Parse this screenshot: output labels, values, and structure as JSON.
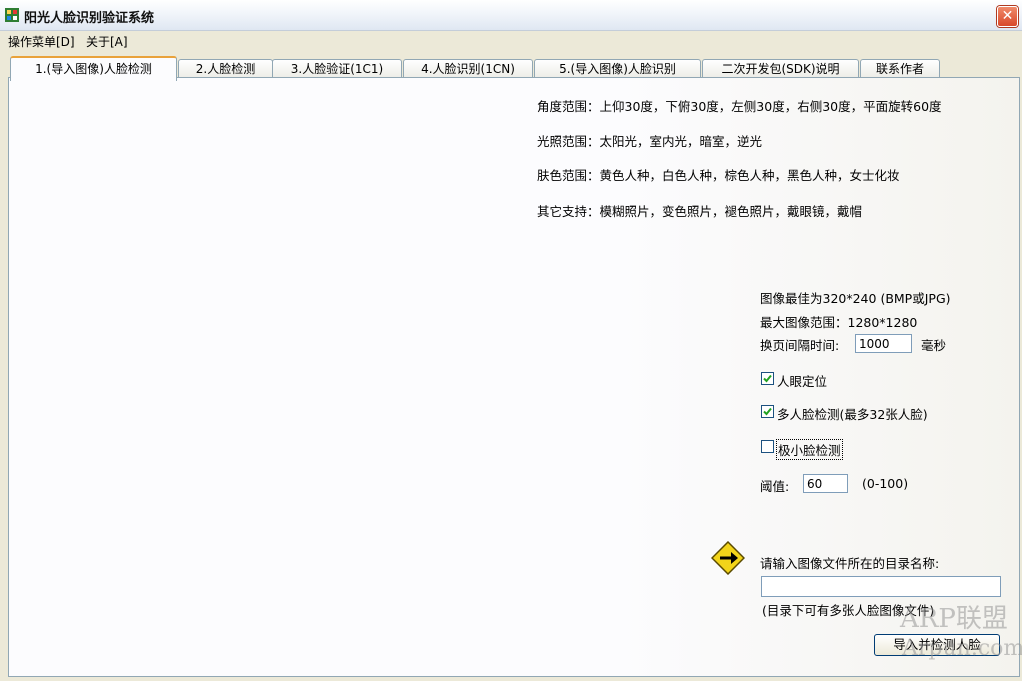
{
  "window": {
    "title": "阳光人脸识别验证系统",
    "close_glyph": "✕"
  },
  "menu": [
    {
      "label": "操作菜单[D]"
    },
    {
      "label": "关于[A]"
    }
  ],
  "tabs": [
    {
      "label": "1.(导入图像)人脸检测",
      "active": true
    },
    {
      "label": "2.人脸检测"
    },
    {
      "label": "3.人脸验证(1C1)"
    },
    {
      "label": "4.人脸识别(1CN)"
    },
    {
      "label": "5.(导入图像)人脸识别"
    },
    {
      "label": "二次开发包(SDK)说明"
    },
    {
      "label": "联系作者"
    }
  ],
  "info": {
    "angle": "角度范围：上仰30度，下俯30度，左侧30度，右侧30度，平面旋转60度",
    "light": "光照范围：太阳光，室内光，暗室，逆光",
    "skin": "肤色范围：黄色人种，白色人种，棕色人种，黑色人种，女士化妆",
    "other": "其它支持：模糊照片，变色照片，褪色照片，戴眼镜，戴帽"
  },
  "settings": {
    "best_size": "图像最佳为320*240 (BMP或JPG)",
    "max_size": "最大图像范围：1280*1280",
    "interval_label": "换页间隔时间:",
    "interval_value": "1000",
    "interval_unit": "毫秒",
    "eye_locate": {
      "label": "人眼定位",
      "checked": true
    },
    "multi_face": {
      "label": "多人脸检测(最多32张人脸)",
      "checked": true
    },
    "tiny_face": {
      "label": "极小脸检测",
      "checked": false
    },
    "threshold_label": "阈值:",
    "threshold_value": "60",
    "threshold_range": "(0-100)"
  },
  "import": {
    "prompt": "请输入图像文件所在的目录名称:",
    "dir_value": "",
    "hint": "(目录下可有多张人脸图像文件)",
    "button": "导入并检测人脸"
  },
  "watermark": {
    "line1": "ARP联盟",
    "line2": "Arpun.com"
  },
  "icons": {
    "app": "app-icon",
    "arrow": "arrow-right-icon",
    "close": "close-icon"
  }
}
